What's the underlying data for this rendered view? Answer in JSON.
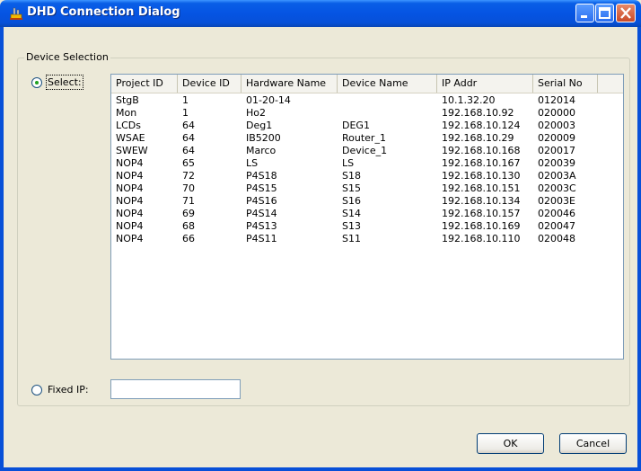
{
  "window": {
    "title": "DHD Connection Dialog",
    "icon": "app-plug-icon"
  },
  "group": {
    "label": "Device Selection"
  },
  "radios": {
    "select_label": "Select:",
    "fixed_label": "Fixed IP:",
    "selected": "select"
  },
  "table": {
    "columns": [
      "Project ID",
      "Device ID",
      "Hardware Name",
      "Device Name",
      "IP Addr",
      "Serial No"
    ],
    "rows": [
      [
        "StgB",
        "1",
        "01-20-14",
        "",
        "10.1.32.20",
        "012014"
      ],
      [
        "Mon",
        "1",
        "Ho2",
        "",
        "192.168.10.92",
        "020000"
      ],
      [
        "LCDs",
        "64",
        "Deg1",
        "DEG1",
        "192.168.10.124",
        "020003"
      ],
      [
        "WSAE",
        "64",
        "IB5200",
        "Router_1",
        "192.168.10.29",
        "020009"
      ],
      [
        "SWEW",
        "64",
        "Marco",
        "Device_1",
        "192.168.10.168",
        "020017"
      ],
      [
        "NOP4",
        "65",
        "LS",
        "LS",
        "192.168.10.167",
        "020039"
      ],
      [
        "NOP4",
        "72",
        "P4S18",
        "S18",
        "192.168.10.130",
        "02003A"
      ],
      [
        "NOP4",
        "70",
        "P4S15",
        "S15",
        "192.168.10.151",
        "02003C"
      ],
      [
        "NOP4",
        "71",
        "P4S16",
        "S16",
        "192.168.10.134",
        "02003E"
      ],
      [
        "NOP4",
        "69",
        "P4S14",
        "S14",
        "192.168.10.157",
        "020046"
      ],
      [
        "NOP4",
        "68",
        "P4S13",
        "S13",
        "192.168.10.169",
        "020047"
      ],
      [
        "NOP4",
        "66",
        "P4S11",
        "S11",
        "192.168.10.110",
        "020048"
      ]
    ]
  },
  "fixed_ip": {
    "value": ""
  },
  "buttons": {
    "ok": "OK",
    "cancel": "Cancel"
  },
  "colors": {
    "titlebar": "#0554e3",
    "dialog_bg": "#ece9d8"
  }
}
